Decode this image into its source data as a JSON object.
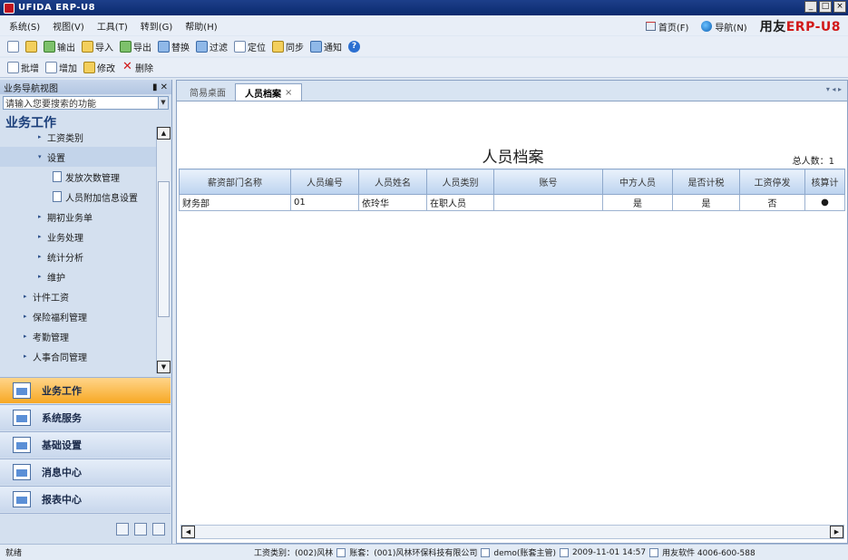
{
  "window": {
    "title": "UFIDA ERP-U8"
  },
  "menu": [
    "系统(S)",
    "视图(V)",
    "工具(T)",
    "转到(G)",
    "帮助(H)"
  ],
  "topright": {
    "home": "首页(F)",
    "nav": "导航(N)",
    "brand_prefix": "用友",
    "brand_main": "ERP",
    "brand_suffix": "-U8"
  },
  "toolbar1": [
    "输出",
    "导入",
    "导出",
    "替换",
    "过滤",
    "定位",
    "同步",
    "通知"
  ],
  "toolbar2": [
    "批增",
    "增加",
    "修改",
    "删除"
  ],
  "left": {
    "header": "业务导航视图",
    "pin": "▮ ✕",
    "search_placeholder": "请输入您要搜索的功能",
    "section": "业务工作",
    "tree": [
      {
        "label": "工资类别",
        "indent": 1,
        "type": "arrow",
        "arrow": "▸"
      },
      {
        "label": "设置",
        "indent": 1,
        "type": "arrow",
        "arrow": "▾",
        "selected": true
      },
      {
        "label": "发放次数管理",
        "indent": 2,
        "type": "doc"
      },
      {
        "label": "人员附加信息设置",
        "indent": 2,
        "type": "doc"
      },
      {
        "label": "期初业务单",
        "indent": 1,
        "type": "arrow",
        "arrow": "▸"
      },
      {
        "label": "业务处理",
        "indent": 1,
        "type": "arrow",
        "arrow": "▸"
      },
      {
        "label": "统计分析",
        "indent": 1,
        "type": "arrow",
        "arrow": "▸"
      },
      {
        "label": "维护",
        "indent": 1,
        "type": "arrow",
        "arrow": "▸"
      },
      {
        "label": "计件工资",
        "indent": 0,
        "type": "arrow",
        "arrow": "▸"
      },
      {
        "label": "保险福利管理",
        "indent": 0,
        "type": "arrow",
        "arrow": "▸"
      },
      {
        "label": "考勤管理",
        "indent": 0,
        "type": "arrow",
        "arrow": "▸"
      },
      {
        "label": "人事合同管理",
        "indent": 0,
        "type": "arrow",
        "arrow": "▸"
      }
    ],
    "nav_buttons": [
      "业务工作",
      "系统服务",
      "基础设置",
      "消息中心",
      "报表中心"
    ]
  },
  "tabs": [
    {
      "label": "简易桌面",
      "active": false
    },
    {
      "label": "人员档案",
      "active": true,
      "close": "×"
    }
  ],
  "tab_nav": "▾ ◂ ▸",
  "report": {
    "title": "人员档案",
    "total": "总人数：1",
    "columns": [
      "薪资部门名称",
      "人员编号",
      "人员姓名",
      "人员类别",
      "账号",
      "中方人员",
      "是否计税",
      "工资停发",
      "核算计"
    ],
    "rows": [
      [
        "财务部",
        "01",
        "依玲华",
        "在职人员",
        "",
        "是",
        "是",
        "否",
        "●"
      ]
    ]
  },
  "status": {
    "left": "就绪",
    "category": "工资类别：(002)风林",
    "account": "账套：(001)风林环保科技有限公司",
    "user": "demo(账套主管)",
    "datetime": "2009-11-01 14:57",
    "hotline": "用友软件 4006-600-588"
  }
}
